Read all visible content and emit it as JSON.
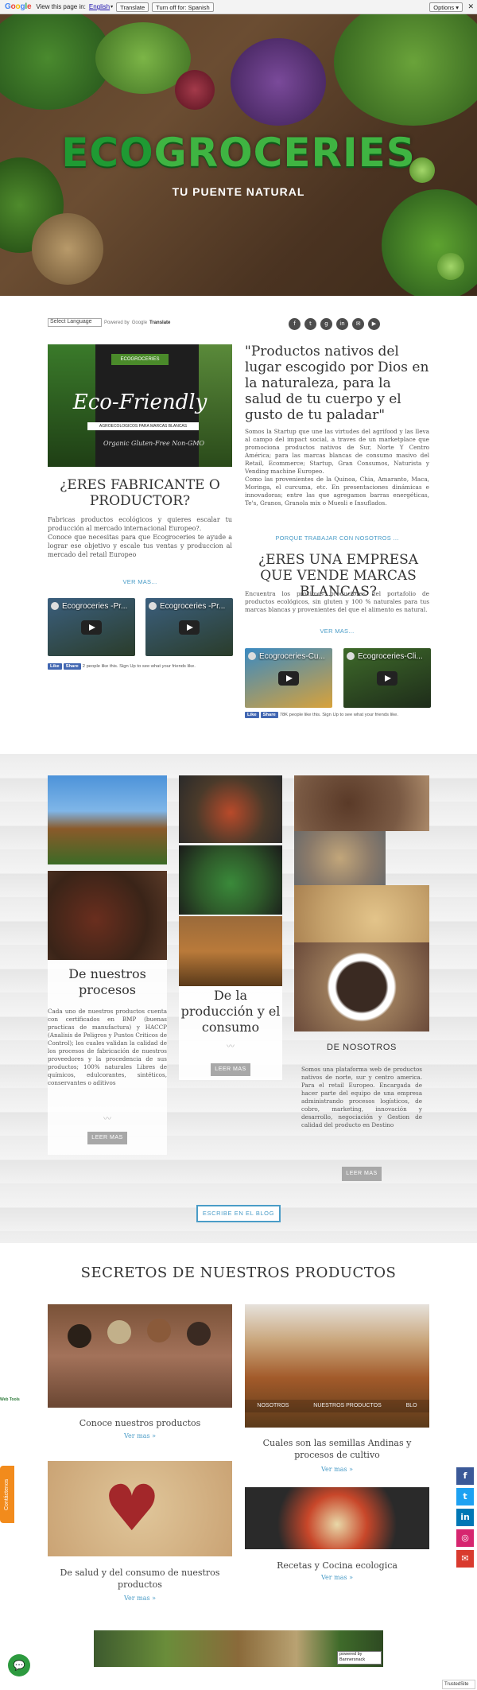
{
  "translate_bar": {
    "google": "Google",
    "view_text": "View this page in:",
    "language": "English",
    "translate_btn": "Translate",
    "turn_off_btn": "Turn off for: Spanish",
    "options_btn": "Options ▾",
    "close": "✕"
  },
  "hero": {
    "logo_eco": "ECO",
    "logo_groceries": "GROCERIES",
    "tagline": "TU PUENTE NATURAL"
  },
  "language_selector": {
    "value": "Select Language",
    "powered_by": "Powered by",
    "google": "Google",
    "translate": "Translate"
  },
  "social_icons": [
    "f",
    "t",
    "g",
    "in",
    "✉",
    "▶"
  ],
  "ad_image": {
    "brand": "ECOGROCERIES",
    "title": "Eco-Friendly",
    "bar": "AGROECOLOGICOS PARA MARCAS BLANCAS",
    "badges": "Organic   Gluten-Free   Non-GMO"
  },
  "quote": "\"Productos nativos del lugar escogido por Dios en la naturaleza, para la salud de tu cuerpo y el gusto de tu paladar\"",
  "right_paragraph": "Somos la Startup que une las virtudes del agrifood y las lleva al campo del impact social, a traves de un marketplace que promociona productos nativos de Sur, Norte Y Centro América; para las marcas blancas de consumo masivo del Retail, Ecommerce; Startup, Gran Consumos, Naturista y Vending machine Europeo.\nComo las provenientes de la Quinoa, Chia, Amaranto, Maca, Moringa, el curcuma, etc. En presentaciones dinámicas e innovadoras; entre las que agregamos barras energéticas, Te's, Granos, Granola mix o Muesli e Insuflados.",
  "why_link": "PORQUE TRABAJAR CON NOSOTROS ...",
  "manufacturer": {
    "heading": "¿ERES FABRICANTE O PRODUCTOR?",
    "text": "Fabricas productos ecológicos y quieres escalar tu producción al mercado internacional Europeo?.\nConoce que necesitas para que Ecogroceries te ayude a lograr ese objetivo y escale tus ventas y produccion al mercado del retail Europeo",
    "link": "VER MAS..."
  },
  "white_label": {
    "heading": "¿ERES UNA EMPRESA QUE VENDE MARCAS BLANCAS?",
    "text": "Encuentra los próximos productores del portafolio de productos ecológicos, sin gluten y 100 % naturales para tus marcas blancas y provenientes del que el alimento es natural.",
    "link": "VER MAS..."
  },
  "videos": [
    {
      "title": "Ecogroceries -Pr..."
    },
    {
      "title": "Ecogroceries -Pr..."
    },
    {
      "title": "Ecogroceries-Cu..."
    },
    {
      "title": "Ecogroceries-Cli..."
    }
  ],
  "fb_left": {
    "like": "Like",
    "share": "Share",
    "text": "2 people like this. Sign Up to see what your friends like."
  },
  "fb_right": {
    "like": "Like",
    "share": "Share",
    "text": "78K people like this. Sign Up to see what your friends like."
  },
  "process_card": {
    "heading": "De nuestros procesos",
    "text": "Cada uno de nuestros productos cuenta con certificados en BMP (buenas practicas de manufactura) y HACCP (Analisis de Peligros y Puntos Criticos de Control); los cuales validan la calidad de los procesos de fabricación de nuestros proveedores y la procedencia de sus productos; 100% naturales Libres de químicos, edulcorantes, sintéticos, conservantes o aditivos",
    "button": "LEER MAS"
  },
  "production_card": {
    "heading": "De la producción y el consumo",
    "button": "LEER MAS"
  },
  "about_card": {
    "heading": "DE NOSOTROS",
    "text": "Somos una plataforma web de productos nativos de norte, sur y centro america. Para el retail Europeo. Encargada de hacer parte del equipo de una empresa administrando procesos logísticos, de cobro, marketing, innovación y desarrollo, negociación y Gestion de calidad del producto en Destino",
    "button": "LEER MAS"
  },
  "blog_button": "ESCRIBE EN EL BLOG",
  "secrets": {
    "title": "SECRETOS DE NUESTROS PRODUCTOS",
    "items": [
      {
        "caption": "Conoce nuestros productos",
        "more": "Ver mas »"
      },
      {
        "caption": "Cuales son las semillas Andinas y procesos de cultivo",
        "more": "Ver mas »"
      },
      {
        "caption": "De salud y del consumo de nuestros productos",
        "more": "Ver mas »"
      },
      {
        "caption": "Recetas y Cocina ecologica",
        "more": "Ver mas »"
      }
    ],
    "overlay_tabs": [
      "NOSOTROS",
      "NUESTROS PRODUCTOS",
      "BLO"
    ]
  },
  "side_social": [
    "f",
    "t",
    "in",
    "◎",
    "✉"
  ],
  "contact_tab": "Contáctenos",
  "powered_by": "powered by Bannersnack",
  "trusted": "TrustedSite",
  "web_badge": "Web Tools",
  "colors": {
    "accent_blue": "#4a9cc7",
    "logo_green": "#1f9a33",
    "contact_orange": "#f28b1c",
    "fb_blue": "#4267b2"
  }
}
